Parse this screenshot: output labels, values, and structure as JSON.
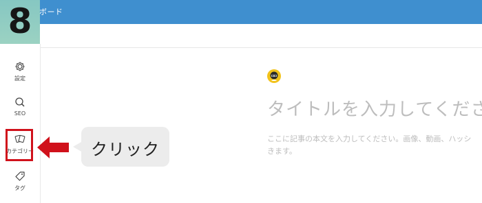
{
  "header": {
    "title": "ボード"
  },
  "step": {
    "number": "8"
  },
  "sidebar": {
    "items": [
      {
        "label": "設定",
        "icon": "gear-icon"
      },
      {
        "label": "SEO",
        "icon": "search-icon"
      },
      {
        "label": "カテゴリー",
        "icon": "category-cards-icon",
        "highlighted": true
      },
      {
        "label": "タグ",
        "icon": "tag-icon"
      }
    ]
  },
  "callout": {
    "text": "クリック"
  },
  "editor": {
    "title_placeholder": "タイトルを入力してくださ",
    "body_placeholder_line1": "ここに記事の本文を入力してください。画像、動画、ハッシ",
    "body_placeholder_line2": "きます。"
  },
  "colors": {
    "header_bg": "#3f8fcf",
    "badge_bg": "#8fcbc2",
    "highlight": "#d0111b",
    "callout_bg": "#ececec"
  }
}
